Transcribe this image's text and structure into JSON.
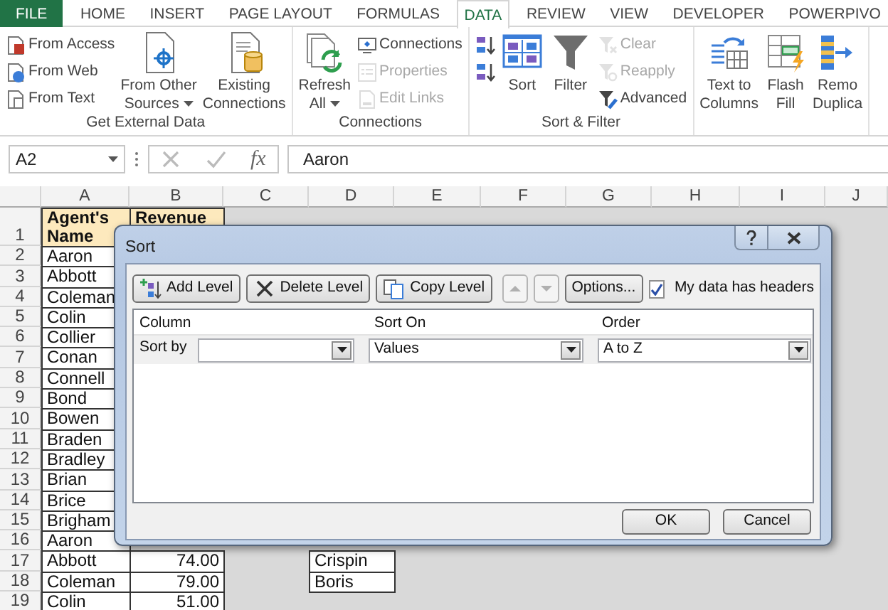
{
  "ribbon_tabs": [
    {
      "label": "FILE",
      "kind": "file",
      "selected": false
    },
    {
      "label": "HOME",
      "kind": "tab",
      "selected": false
    },
    {
      "label": "INSERT",
      "kind": "tab",
      "selected": false
    },
    {
      "label": "PAGE LAYOUT",
      "kind": "tab",
      "selected": false
    },
    {
      "label": "FORMULAS",
      "kind": "tab",
      "selected": false
    },
    {
      "label": "DATA",
      "kind": "tab",
      "selected": true
    },
    {
      "label": "REVIEW",
      "kind": "tab",
      "selected": false
    },
    {
      "label": "VIEW",
      "kind": "tab",
      "selected": false
    },
    {
      "label": "DEVELOPER",
      "kind": "tab",
      "selected": false
    },
    {
      "label": "POWERPIVO",
      "kind": "tab",
      "selected": false
    }
  ],
  "ribbon_groups": [
    {
      "label": "Get External Data",
      "commands": [
        {
          "kind": "small",
          "lines": [
            "From Access"
          ],
          "disabled": false
        },
        {
          "kind": "small",
          "lines": [
            "From Web"
          ],
          "disabled": false
        },
        {
          "kind": "small",
          "lines": [
            "From Text"
          ],
          "disabled": false
        },
        {
          "kind": "large",
          "lines": [
            "From Other",
            "Sources"
          ],
          "menu": true,
          "disabled": false
        },
        {
          "kind": "large",
          "lines": [
            "Existing",
            "Connections"
          ],
          "disabled": false
        }
      ]
    },
    {
      "label": "Connections",
      "commands": [
        {
          "kind": "large",
          "lines": [
            "Refresh",
            "All"
          ],
          "menu": true,
          "disabled": false
        },
        {
          "kind": "small",
          "lines": [
            "Connections"
          ],
          "disabled": false
        },
        {
          "kind": "small",
          "lines": [
            "Properties"
          ],
          "disabled": true
        },
        {
          "kind": "small",
          "lines": [
            "Edit Links"
          ],
          "disabled": true
        }
      ]
    },
    {
      "label": "Sort & Filter",
      "commands": [
        {
          "kind": "small",
          "disabled": false
        },
        {
          "kind": "small",
          "disabled": false
        },
        {
          "kind": "large",
          "lines": [
            "Sort"
          ],
          "disabled": false
        },
        {
          "kind": "large",
          "lines": [
            "Filter"
          ],
          "disabled": false
        },
        {
          "kind": "small",
          "lines": [
            "Clear"
          ],
          "disabled": true
        },
        {
          "kind": "small",
          "lines": [
            "Reapply"
          ],
          "disabled": true
        },
        {
          "kind": "small",
          "lines": [
            "Advanced"
          ],
          "disabled": false
        }
      ]
    },
    {
      "commands": [
        {
          "kind": "large",
          "lines": [
            "Text to",
            "Columns"
          ],
          "disabled": false
        },
        {
          "kind": "large",
          "lines": [
            "Flash",
            "Fill"
          ],
          "disabled": false
        },
        {
          "kind": "large",
          "lines": [
            "Remo",
            "Duplica"
          ],
          "disabled": false
        }
      ]
    }
  ],
  "formula_bar": {
    "name_box": "A2",
    "function_button": "fx",
    "value": "Aaron"
  },
  "sheet": {
    "columns": [
      "A",
      "B",
      "C",
      "D",
      "E",
      "F",
      "G",
      "H",
      "I",
      "J"
    ],
    "rows": [
      {
        "number": "1",
        "header": true,
        "cells": [
          {
            "text": "Agent's Name"
          },
          {
            "text": "Revenue"
          }
        ]
      },
      {
        "number": "2",
        "cells": [
          {
            "text": "Aaron"
          }
        ]
      },
      {
        "number": "3",
        "cells": [
          {
            "text": "Abbott"
          }
        ]
      },
      {
        "number": "4",
        "cells": [
          {
            "text": "Coleman"
          }
        ]
      },
      {
        "number": "5",
        "cells": [
          {
            "text": "Colin"
          }
        ]
      },
      {
        "number": "6",
        "cells": [
          {
            "text": "Collier"
          }
        ]
      },
      {
        "number": "7",
        "cells": [
          {
            "text": "Conan"
          }
        ]
      },
      {
        "number": "8",
        "cells": [
          {
            "text": "Connell"
          }
        ]
      },
      {
        "number": "9",
        "cells": [
          {
            "text": "Bond"
          }
        ]
      },
      {
        "number": "10",
        "cells": [
          {
            "text": "Bowen"
          }
        ]
      },
      {
        "number": "11",
        "cells": [
          {
            "text": "Braden"
          }
        ]
      },
      {
        "number": "12",
        "cells": [
          {
            "text": "Bradley"
          }
        ]
      },
      {
        "number": "13",
        "cells": [
          {
            "text": "Brian"
          }
        ]
      },
      {
        "number": "14",
        "cells": [
          {
            "text": "Brice"
          }
        ]
      },
      {
        "number": "15",
        "cells": [
          {
            "text": "Brigham"
          }
        ]
      },
      {
        "number": "16",
        "cells": [
          {
            "text": "Aaron"
          }
        ]
      },
      {
        "number": "17",
        "cells": [
          {
            "text": "Abbott"
          },
          {
            "text": "74.00",
            "numeric": true
          },
          null,
          {
            "text": "Crispin"
          }
        ]
      },
      {
        "number": "18",
        "cells": [
          {
            "text": "Coleman"
          },
          {
            "text": "79.00",
            "numeric": true
          },
          null,
          {
            "text": "Boris"
          }
        ]
      },
      {
        "number": "19",
        "cells": [
          {
            "text": "Colin"
          },
          {
            "text": "51.00",
            "numeric": true
          }
        ]
      }
    ]
  },
  "dialog": {
    "title": "Sort",
    "toolbar": [
      {
        "kind": "add",
        "label": "Add Level",
        "disabled": false
      },
      {
        "kind": "delete",
        "label": "Delete Level",
        "disabled": false
      },
      {
        "kind": "copy",
        "label": "Copy Level",
        "disabled": false
      },
      {
        "kind": "up",
        "disabled": true
      },
      {
        "kind": "down",
        "disabled": true
      },
      {
        "kind": "text",
        "label": "Options...",
        "disabled": false
      }
    ],
    "headers_checkbox": {
      "label": "My data has headers",
      "checked": true
    },
    "columns": [
      "Column",
      "Sort On",
      "Order"
    ],
    "levels": [
      {
        "label": "Sort by",
        "sort_on": "Values",
        "order": "A to Z"
      }
    ],
    "buttons": [
      "OK",
      "Cancel"
    ]
  }
}
